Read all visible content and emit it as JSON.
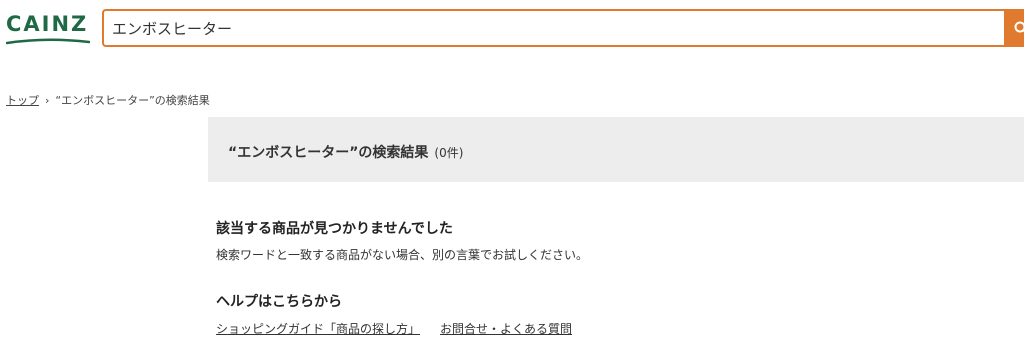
{
  "header": {
    "logo_text": "CAINZ",
    "search_value": "エンボスヒーター",
    "brand_color": "#1f6a45",
    "accent_color": "#e07a2e",
    "search_icon": "search-icon"
  },
  "breadcrumb": {
    "home": "トップ",
    "separator": "›",
    "current": "“エンボスヒーター”の検索結果"
  },
  "results": {
    "title": "“エンボスヒーター”の検索結果",
    "count": "(0件)"
  },
  "no_results": {
    "heading": "該当する商品が見つかりませんでした",
    "message": "検索ワードと一致する商品がない場合、別の言葉でお試しください。"
  },
  "help": {
    "heading": "ヘルプはこちらから",
    "links": [
      "ショッピングガイド「商品の探し方」",
      "お問合せ・よくある質問"
    ]
  }
}
